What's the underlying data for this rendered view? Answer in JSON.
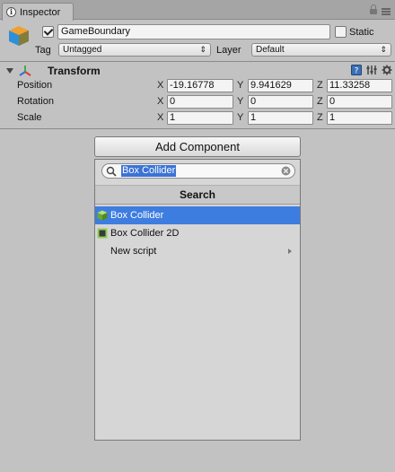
{
  "tab": {
    "title": "Inspector",
    "icon": "info-icon"
  },
  "object": {
    "active": true,
    "name": "GameBoundary",
    "static_label": "Static",
    "static": false,
    "tag_label": "Tag",
    "tag_value": "Untagged",
    "layer_label": "Layer",
    "layer_value": "Default"
  },
  "transform": {
    "title": "Transform",
    "rows": [
      {
        "label": "Position",
        "x": "-19.16778",
        "y": "9.941629",
        "z": "11.33258"
      },
      {
        "label": "Rotation",
        "x": "0",
        "y": "0",
        "z": "0"
      },
      {
        "label": "Scale",
        "x": "1",
        "y": "1",
        "z": "1"
      }
    ],
    "axes": {
      "x": "X",
      "y": "Y",
      "z": "Z"
    }
  },
  "add_component": {
    "button_label": "Add Component",
    "search_value": "Box Collider",
    "header": "Search",
    "items": [
      {
        "label": "Box Collider",
        "icon": "box-collider-icon",
        "selected": true
      },
      {
        "label": "Box Collider 2D",
        "icon": "box-collider-2d-icon",
        "selected": false
      },
      {
        "label": "New script",
        "icon": "",
        "selected": false,
        "has_submenu": true
      }
    ]
  },
  "colors": {
    "panel_bg": "#c2c2c2",
    "selection": "#3e7de0",
    "search_highlight": "#3b73d6"
  }
}
